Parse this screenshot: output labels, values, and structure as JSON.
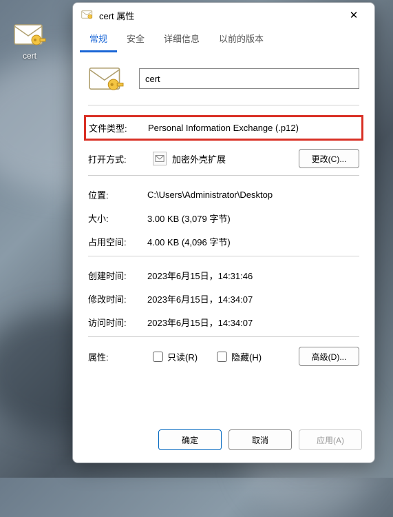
{
  "desktop": {
    "icon_label": "cert"
  },
  "dialog": {
    "title": "cert 属性",
    "tabs": [
      "常规",
      "安全",
      "详细信息",
      "以前的版本"
    ],
    "active_tab_index": 0,
    "name_value": "cert",
    "rows": {
      "file_type_label": "文件类型:",
      "file_type_value": "Personal Information Exchange (.p12)",
      "open_with_label": "打开方式:",
      "open_with_app": "加密外壳扩展",
      "change_button": "更改(C)...",
      "location_label": "位置:",
      "location_value": "C:\\Users\\Administrator\\Desktop",
      "size_label": "大小:",
      "size_value": "3.00 KB (3,079 字节)",
      "size_on_disk_label": "占用空间:",
      "size_on_disk_value": "4.00 KB (4,096 字节)",
      "created_label": "创建时间:",
      "created_value": "2023年6月15日，14:31:46",
      "modified_label": "修改时间:",
      "modified_value": "2023年6月15日，14:34:07",
      "accessed_label": "访问时间:",
      "accessed_value": "2023年6月15日，14:34:07",
      "attributes_label": "属性:",
      "readonly_label": "只读(R)",
      "hidden_label": "隐藏(H)",
      "advanced_button": "高级(D)..."
    },
    "footer": {
      "ok": "确定",
      "cancel": "取消",
      "apply": "应用(A)"
    }
  }
}
